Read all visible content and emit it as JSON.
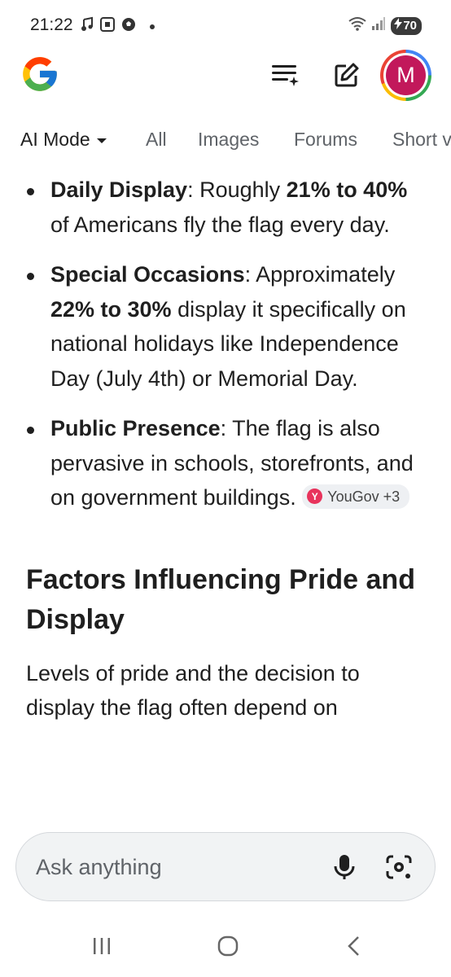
{
  "status_bar": {
    "time": "21:22",
    "battery": "70"
  },
  "header": {
    "avatar_letter": "M"
  },
  "tabs": [
    {
      "label": "AI Mode"
    },
    {
      "label": "All"
    },
    {
      "label": "Images"
    },
    {
      "label": "Forums"
    },
    {
      "label": "Short v"
    }
  ],
  "bullets": [
    {
      "label": "Daily Display",
      "pre": ": Roughly ",
      "bold": "21% to 40%",
      "post": " of Americans fly the flag every day."
    },
    {
      "label": "Special Occasions",
      "pre": ": Approximately ",
      "bold": "22% to 30%",
      "post": " display it specifically on national holidays like Independence Day (July 4th) or Memorial Day."
    },
    {
      "label": "Public Presence",
      "text": ": The flag is also pervasive in schools, storefronts, and on government buildings.",
      "source": {
        "name": "YouGov +3",
        "logo": "Y"
      }
    }
  ],
  "section_heading": "Factors Influencing Pride and Display",
  "paragraph": "Levels of pride and the decision to display the flag often depend on",
  "ask_bar": {
    "placeholder": "Ask anything"
  },
  "colors": {
    "avatar": "#c2185b",
    "source_logo": "#e8335c",
    "chip_bg": "#eef0f3"
  },
  "icons": [
    "google-logo-icon",
    "history-sparkle-icon",
    "new-chat-icon",
    "mic-icon",
    "lens-icon",
    "recents-nav-icon",
    "home-nav-icon",
    "back-nav-icon"
  ]
}
